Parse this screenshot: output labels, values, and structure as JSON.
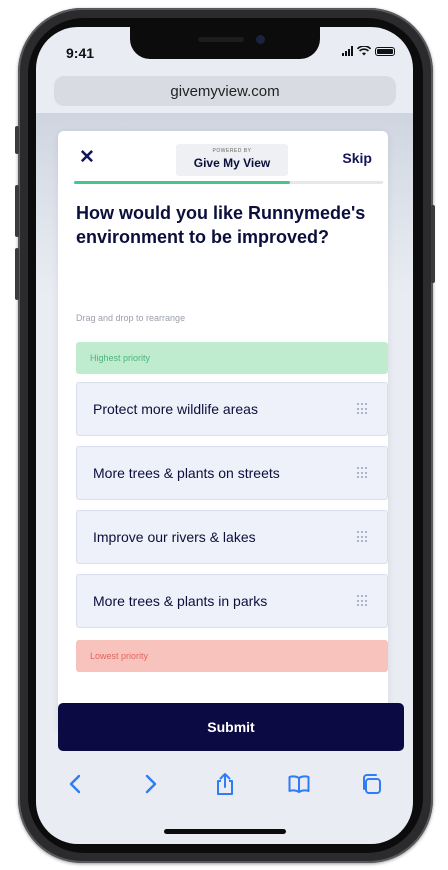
{
  "status": {
    "time": "9:41"
  },
  "browser": {
    "url": "givemyview.com"
  },
  "header": {
    "close_icon": "close-icon",
    "logo_powered": "POWERED BY",
    "logo_name": "Give My View",
    "skip_label": "Skip",
    "progress_fraction": 0.7
  },
  "question": {
    "title": "How would you like Runnymede's environment to be improved?",
    "hint": "Drag and drop to rearrange"
  },
  "priority": {
    "highest_label": "Highest priority",
    "lowest_label": "Lowest priority"
  },
  "ranking": {
    "items": [
      {
        "label": "Protect more wildlife areas"
      },
      {
        "label": "More trees & plants on streets"
      },
      {
        "label": "Improve our rivers & lakes"
      },
      {
        "label": "More trees & plants in parks"
      }
    ]
  },
  "submit": {
    "label": "Submit"
  },
  "toolbar": {
    "icons": [
      "chevron-left-icon",
      "chevron-right-icon",
      "share-icon",
      "bookmarks-icon",
      "tabs-icon"
    ]
  },
  "colors": {
    "brand_navy": "#0b0a43",
    "accent_green": "#46c58b",
    "ios_blue": "#2f7cf6",
    "highest_bg": "#bfeccf",
    "lowest_bg": "#f8c3bd"
  }
}
